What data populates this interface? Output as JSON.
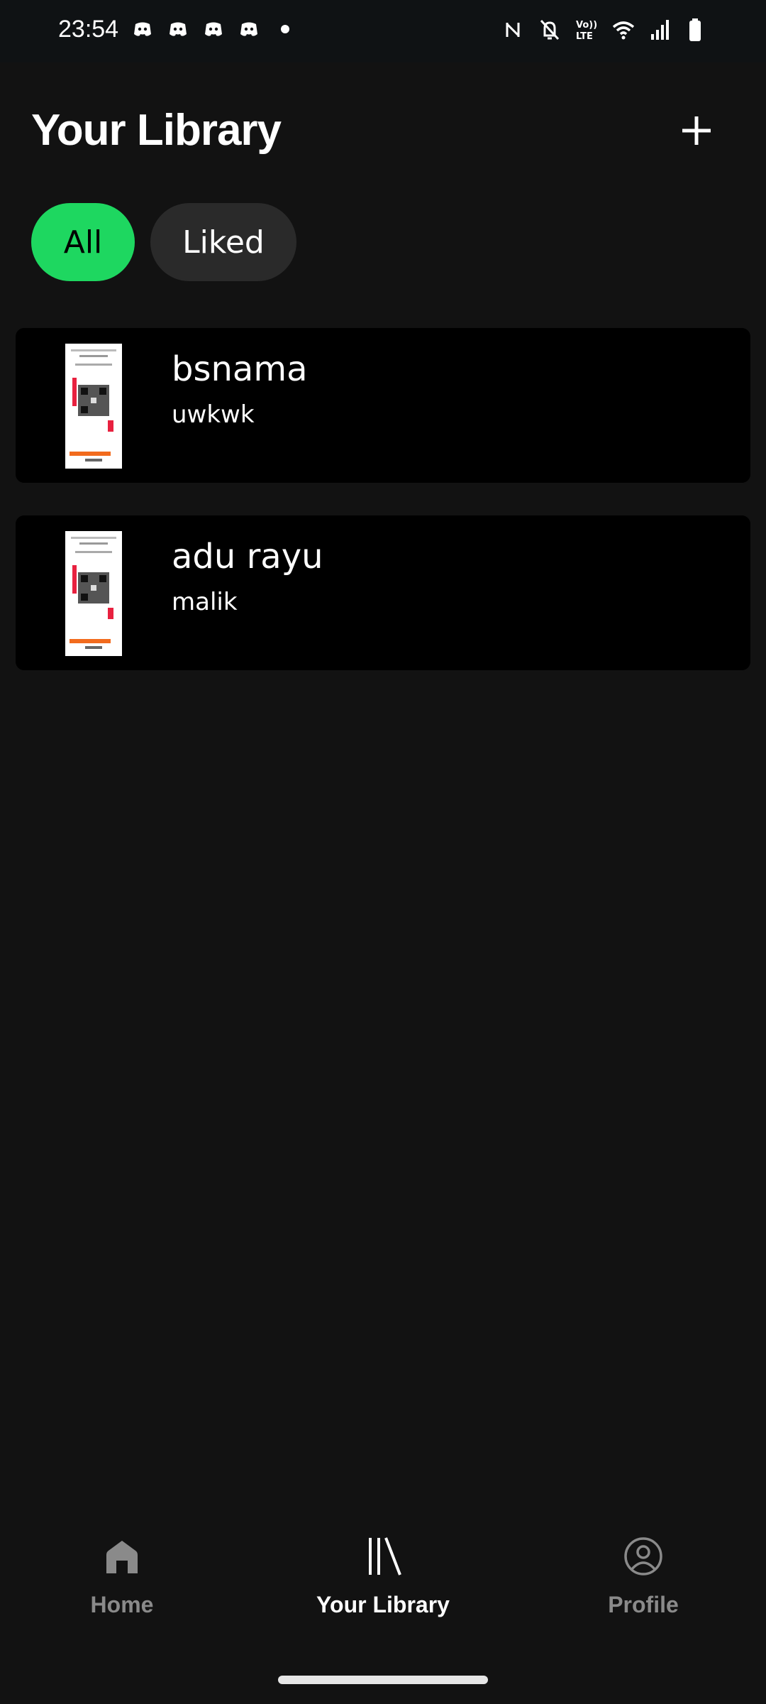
{
  "status_bar": {
    "time": "23:54",
    "notification_icons": [
      "discord-icon",
      "discord-icon",
      "discord-icon",
      "discord-icon"
    ],
    "system_icons": [
      "nfc-icon",
      "bell-off-icon",
      "volte-icon",
      "wifi-icon",
      "signal-icon",
      "battery-icon"
    ]
  },
  "header": {
    "title": "Your Library",
    "add_icon": "plus-icon"
  },
  "filters": {
    "all_label": "All",
    "liked_label": "Liked",
    "selected": "All"
  },
  "items": [
    {
      "title": "bsnama",
      "subtitle": "uwkwk",
      "thumbnail": "qr-receipt-thumbnail"
    },
    {
      "title": "adu rayu",
      "subtitle": "malik",
      "thumbnail": "qr-receipt-thumbnail"
    }
  ],
  "bottom_nav": {
    "home_label": "Home",
    "library_label": "Your Library",
    "profile_label": "Profile",
    "active": "Your Library"
  },
  "colors": {
    "accent": "#1ed760",
    "background": "#121212",
    "card": "#000000",
    "chip_inactive": "#2a2a2a"
  }
}
